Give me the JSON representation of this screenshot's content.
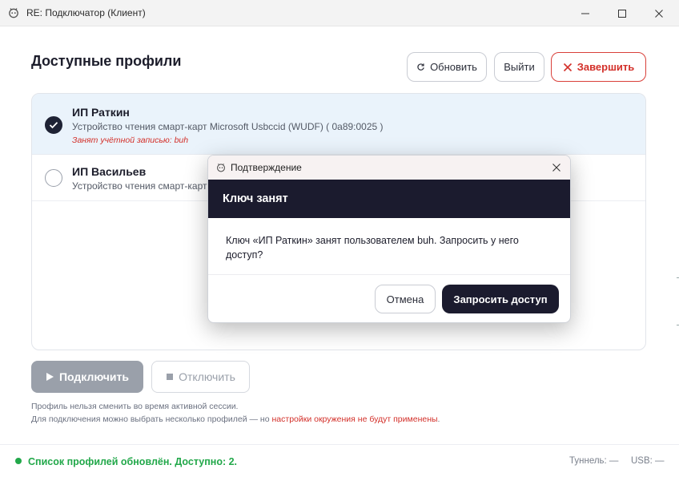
{
  "window": {
    "title": "RE: Подключатор (Клиент)",
    "app_icon": "app-icon",
    "controls": [
      "minimize-icon",
      "maximize-icon",
      "close-icon"
    ]
  },
  "main": {
    "title": "Доступные профили",
    "refresh_label": "Обновить",
    "refresh_icon": "refresh-icon",
    "exit_label": "Выйти",
    "finish_label": "Завершить",
    "finish_icon": "x-icon"
  },
  "profiles": [
    {
      "name": "ИП Раткин",
      "device": "Устройство чтения смарт-карт Microsoft Usbccid (WUDF)  ( 0a89:0025 )",
      "busy": "Занят учётной записью: buh",
      "selected": true
    },
    {
      "name": "ИП Васильев",
      "device": "Устройство чтения смарт-карт",
      "selected": false
    }
  ],
  "actions": {
    "connect_label": "Подключить",
    "connect_icon": "play-icon",
    "disconnect_label": "Отключить",
    "disconnect_icon": "stop-icon"
  },
  "hints": {
    "line1": "Профиль нельзя сменить во время активной сессии.",
    "line2_prefix": "Для подключения можно выбрать несколько профилей — но ",
    "line2_warning": "настройки окружения не будут применены",
    "line2_suffix": "."
  },
  "status": {
    "message": "Список профилей обновлён. Доступно: 2.",
    "tunnel": "Туннель: —",
    "usb": "USB: —"
  },
  "dialog": {
    "title": "Подтверждение",
    "header": "Ключ занят",
    "message_line1": "Ключ «ИП Раткин» занят пользователем buh. Запросить у него",
    "message_line2": "доступ?",
    "cancel_label": "Отмена",
    "request_label": "Запросить доступ"
  },
  "colors": {
    "accent_dark": "#1b1b2e",
    "danger": "#d3302a",
    "success": "#22a84a",
    "selected_row": "#eaf3fb"
  }
}
